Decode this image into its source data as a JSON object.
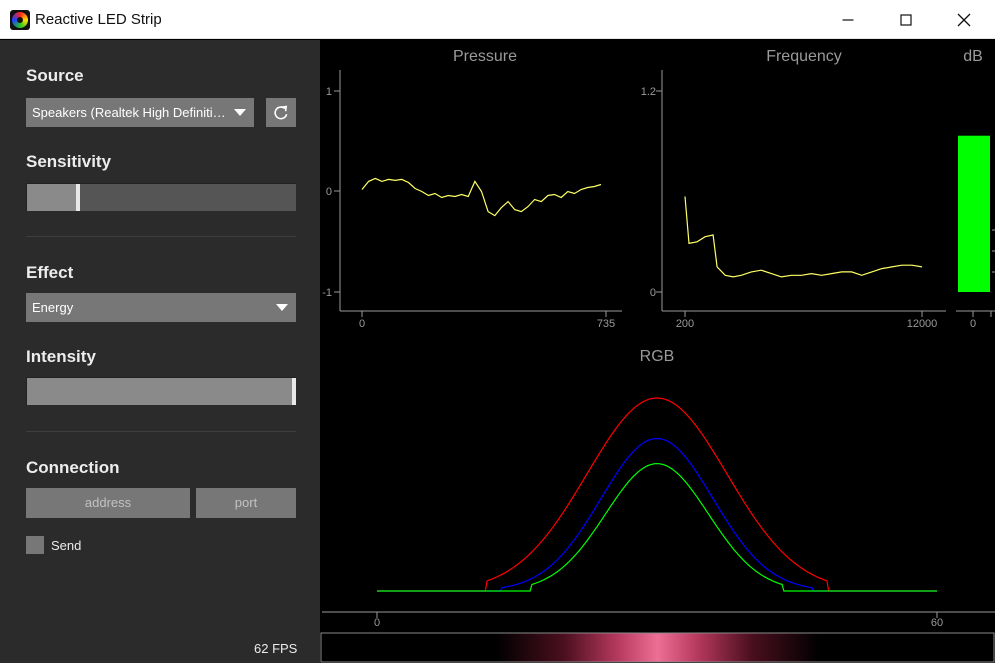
{
  "window": {
    "title": "Reactive LED Strip",
    "controls": {
      "minimize": "minimize",
      "maximize": "maximize",
      "close": "close"
    }
  },
  "sidebar": {
    "source": {
      "title": "Source",
      "device": "Speakers (Realtek High Definition Audio)",
      "refresh_icon": "refresh-icon"
    },
    "sensitivity": {
      "title": "Sensitivity",
      "level": 0.19
    },
    "effect": {
      "title": "Effect",
      "selected": "Energy"
    },
    "intensity": {
      "title": "Intensity",
      "level": 1.0
    },
    "connection": {
      "title": "Connection",
      "address_placeholder": "address",
      "port_placeholder": "port",
      "send_label": "Send",
      "send_checked": false
    },
    "fps": "62 FPS"
  },
  "plots": {
    "pressure": {
      "title": "Pressure",
      "y_ticks": [
        "1",
        "0",
        "-1"
      ],
      "x_ticks": [
        "0",
        "735"
      ],
      "line_color": "#ffff66"
    },
    "frequency": {
      "title": "Frequency",
      "y_ticks": [
        "1.2",
        "0"
      ],
      "x_ticks": [
        "200",
        "12000"
      ],
      "line_color": "#ffff66"
    },
    "db": {
      "title": "dB",
      "x_ticks": [
        "0"
      ],
      "bar_color": "#00ff00"
    },
    "rgb": {
      "title": "RGB",
      "x_ticks": [
        "0",
        "60"
      ],
      "colors": {
        "red": "#ff0000",
        "green": "#00ff00",
        "blue": "#0000ff"
      }
    }
  },
  "chart_data": [
    {
      "type": "line",
      "title": "Pressure",
      "xlim": [
        0,
        735
      ],
      "ylim": [
        -1.2,
        1.2
      ],
      "x": [
        0,
        20,
        40,
        60,
        80,
        100,
        120,
        140,
        160,
        180,
        200,
        220,
        240,
        260,
        280,
        300,
        320,
        340,
        360,
        380,
        400,
        420,
        440,
        460,
        480,
        500,
        520,
        540,
        560,
        580,
        600,
        620,
        640,
        660,
        680,
        700,
        720
      ],
      "values": [
        0.02,
        0.1,
        0.13,
        0.1,
        0.12,
        0.11,
        0.12,
        0.09,
        0.03,
        0.0,
        -0.04,
        -0.02,
        -0.06,
        -0.04,
        -0.05,
        -0.03,
        -0.05,
        0.1,
        0.0,
        -0.2,
        -0.24,
        -0.16,
        -0.1,
        -0.18,
        -0.2,
        -0.15,
        -0.08,
        -0.1,
        -0.04,
        -0.03,
        -0.06,
        0.0,
        -0.02,
        0.02,
        0.04,
        0.05,
        0.07
      ]
    },
    {
      "type": "line",
      "title": "Frequency",
      "xlim": [
        200,
        12000
      ],
      "ylim": [
        0,
        1.2
      ],
      "x": [
        200,
        400,
        800,
        1200,
        1600,
        1800,
        2200,
        2600,
        3000,
        3500,
        4000,
        4500,
        5000,
        5500,
        6000,
        6500,
        7000,
        7500,
        8000,
        8500,
        9000,
        9500,
        10000,
        10500,
        11000,
        11500,
        12000
      ],
      "values": [
        0.57,
        0.29,
        0.3,
        0.33,
        0.34,
        0.15,
        0.1,
        0.09,
        0.1,
        0.12,
        0.13,
        0.11,
        0.09,
        0.1,
        0.1,
        0.11,
        0.1,
        0.11,
        0.12,
        0.12,
        0.1,
        0.12,
        0.14,
        0.15,
        0.16,
        0.16,
        0.15
      ]
    },
    {
      "type": "bar",
      "title": "dB",
      "categories": [
        "0"
      ],
      "values": [
        0.77
      ],
      "ylim": [
        0,
        1
      ]
    },
    {
      "type": "line",
      "title": "RGB",
      "xlim": [
        0,
        60
      ],
      "series": [
        {
          "color": "red",
          "peak": 1.0,
          "center": 30,
          "width": 7.5,
          "threshold": 0.05
        },
        {
          "color": "blue",
          "peak": 0.79,
          "center": 30,
          "width": 6.0,
          "threshold": 0.02
        },
        {
          "color": "green",
          "peak": 0.66,
          "center": 30,
          "width": 5.5,
          "threshold": 0.05
        }
      ]
    }
  ]
}
